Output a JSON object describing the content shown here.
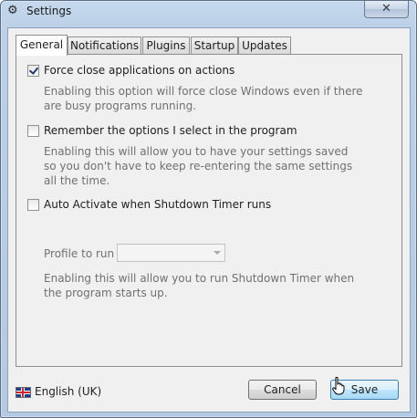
{
  "window": {
    "title": "Settings",
    "title_icon": "gear-icon",
    "close_glyph": "✕"
  },
  "tabs": [
    {
      "label": "General",
      "active": true
    },
    {
      "label": "Notifications",
      "active": false
    },
    {
      "label": "Plugins",
      "active": false
    },
    {
      "label": "Startup",
      "active": false
    },
    {
      "label": "Updates",
      "active": false
    }
  ],
  "general": {
    "force_close": {
      "label": "Force close applications on actions",
      "checked": true,
      "description": [
        "Enabling this option will force close Windows even if there",
        "are busy programs running."
      ]
    },
    "remember_options": {
      "label": "Remember the options I select in the program",
      "checked": false,
      "description": [
        "Enabling this will allow you to have your settings saved",
        "so you don't have to keep re-entering the same settings",
        "all the time."
      ]
    },
    "auto_activate": {
      "label": "Auto Activate when Shutdown Timer runs",
      "checked": false,
      "profile_label": "Profile to run",
      "profile_value": "",
      "description": [
        "Enabling this will allow you to run Shutdown Timer when",
        "the program starts up."
      ]
    }
  },
  "footer": {
    "language": "English (UK)",
    "language_icon": "uk-flag-icon",
    "cancel_label": "Cancel",
    "save_label": "Save"
  },
  "colors": {
    "title_bar": "#bcd1e8",
    "panel": "#f0f0f0",
    "description_text": "#707070",
    "primary_button_border": "#3c7fb1"
  }
}
